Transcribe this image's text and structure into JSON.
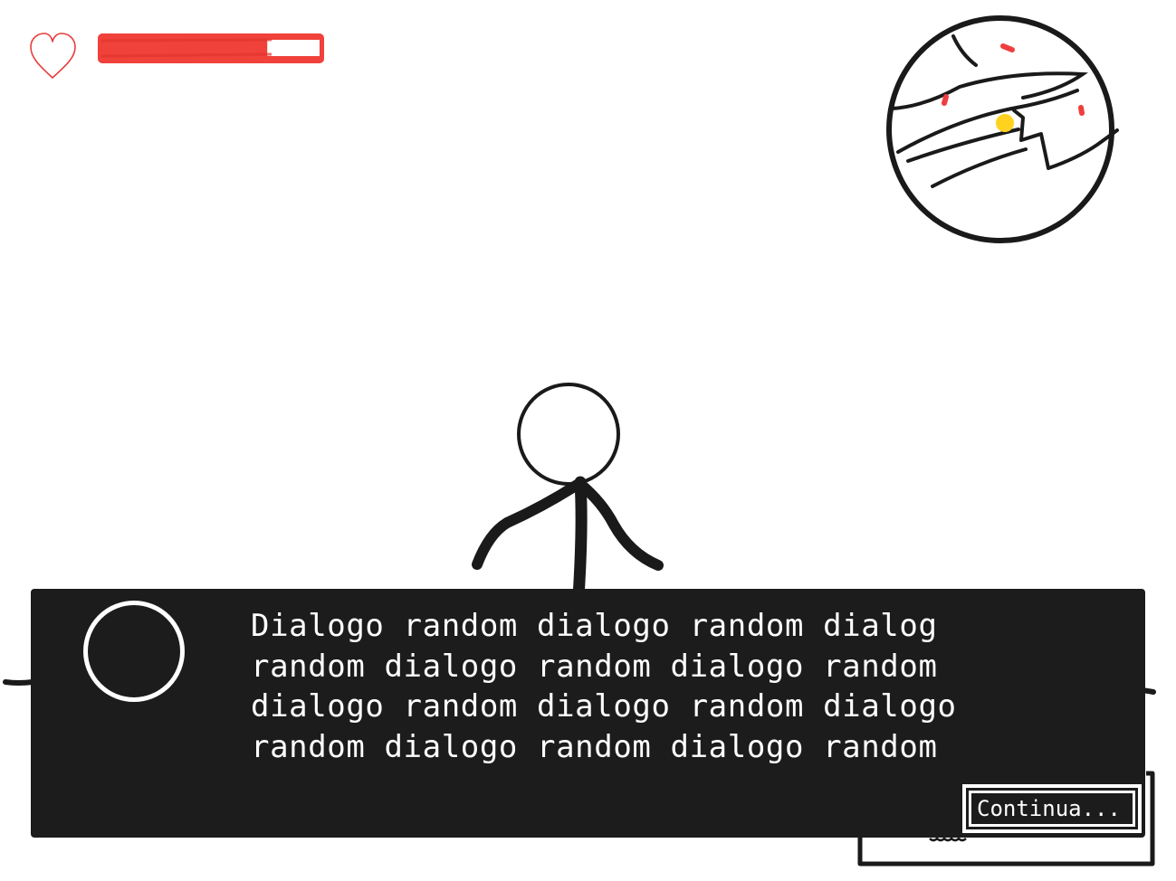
{
  "hud": {
    "health_icon": "heart-icon",
    "health_fraction": 0.76,
    "health_color": "#f0413a",
    "heart_color": "#e83d3d"
  },
  "minimap": {
    "icon": "minimap",
    "player_marker_color": "#ffd21f",
    "enemy_marker_color": "#ef3e3e"
  },
  "dialog": {
    "lines": [
      "Dialogo random dialogo random dialog",
      "random dialogo random dialogo random",
      "dialogo random dialogo random dialogo",
      "random dialogo random dialogo random"
    ],
    "continue_label": "Continua...",
    "panel_color": "#1c1c1c",
    "text_color": "#ffffff"
  }
}
